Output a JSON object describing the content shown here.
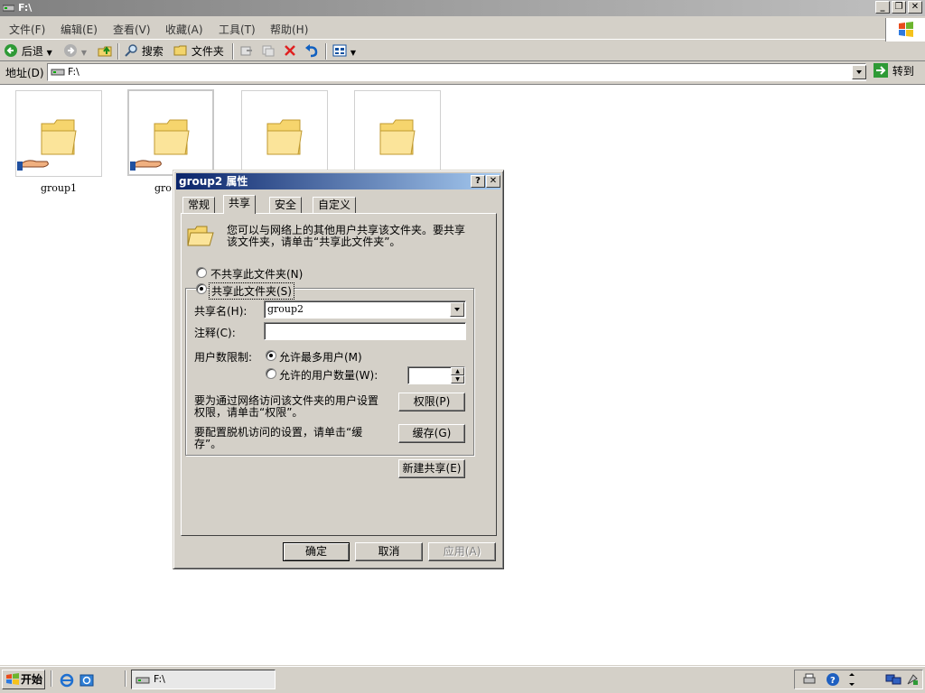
{
  "window": {
    "title": "F:\\"
  },
  "menu": {
    "items": [
      "文件(F)",
      "编辑(E)",
      "查看(V)",
      "收藏(A)",
      "工具(T)",
      "帮助(H)"
    ]
  },
  "toolbar": {
    "back_label": "后退",
    "search_label": "搜索",
    "folders_label": "文件夹"
  },
  "address": {
    "label": "地址(D)",
    "value": "F:\\",
    "go_label": "转到"
  },
  "folders": [
    {
      "label": "group1",
      "shared": true
    },
    {
      "label": "gro",
      "shared": true
    },
    {
      "label": "",
      "shared": false
    },
    {
      "label": "",
      "shared": false
    }
  ],
  "dialog": {
    "title": "group2 属性",
    "tabs": [
      "常规",
      "共享",
      "安全",
      "自定义"
    ],
    "active_tab": "共享",
    "intro_line1": "您可以与网络上的其他用户共享该文件夹。要共享",
    "intro_line2": "该文件夹，请单击“共享此文件夹”。",
    "no_share_label": "不共享此文件夹(N)",
    "share_label": "共享此文件夹(S)",
    "share_name_label": "共享名(H):",
    "share_name_value": "group2",
    "comment_label": "注释(C):",
    "comment_value": "",
    "user_limit_label": "用户数限制:",
    "max_users_label": "允许最多用户(M)",
    "allowed_users_label": "允许的用户数量(W):",
    "allowed_users_value": "",
    "permissions_text_line1": "要为通过网络访问该文件夹的用户设置",
    "permissions_text_line2": "权限，请单击“权限”。",
    "permissions_button": "权限(P)",
    "caching_text_line1": "要配置脱机访问的设置，请单击“缓",
    "caching_text_line2": "存”。",
    "caching_button": "缓存(G)",
    "new_share_button": "新建共享(E)",
    "ok_button": "确定",
    "cancel_button": "取消",
    "apply_button": "应用(A)"
  },
  "taskbar": {
    "start_label": "开始",
    "task_label": "F:\\"
  }
}
